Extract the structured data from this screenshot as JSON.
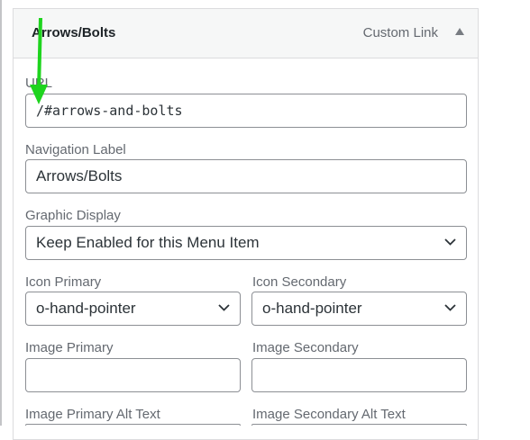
{
  "panel": {
    "title": "Arrows/Bolts",
    "item_type": "Custom Link"
  },
  "fields": {
    "url": {
      "label": "URL",
      "value": "/#arrows-and-bolts"
    },
    "nav_label": {
      "label": "Navigation Label",
      "value": "Arrows/Bolts"
    },
    "graphic_display": {
      "label": "Graphic Display",
      "value": "Keep Enabled for this Menu Item"
    },
    "icon_primary": {
      "label": "Icon Primary",
      "value": "o-hand-pointer"
    },
    "icon_secondary": {
      "label": "Icon Secondary",
      "value": "o-hand-pointer"
    },
    "image_primary": {
      "label": "Image Primary",
      "value": ""
    },
    "image_secondary": {
      "label": "Image Secondary",
      "value": ""
    },
    "image_primary_alt": {
      "label": "Image Primary Alt Text",
      "value": ""
    },
    "image_secondary_alt": {
      "label": "Image Secondary Alt Text",
      "value": ""
    }
  },
  "colors": {
    "annotation_arrow": "#1ed41e",
    "border": "#8c8f94",
    "label": "#646970",
    "header_bg": "#f6f7f7"
  },
  "icons": {
    "collapse": "triangle-up-icon",
    "select": "chevron-down-icon",
    "annotation": "green-arrow-down-icon"
  }
}
